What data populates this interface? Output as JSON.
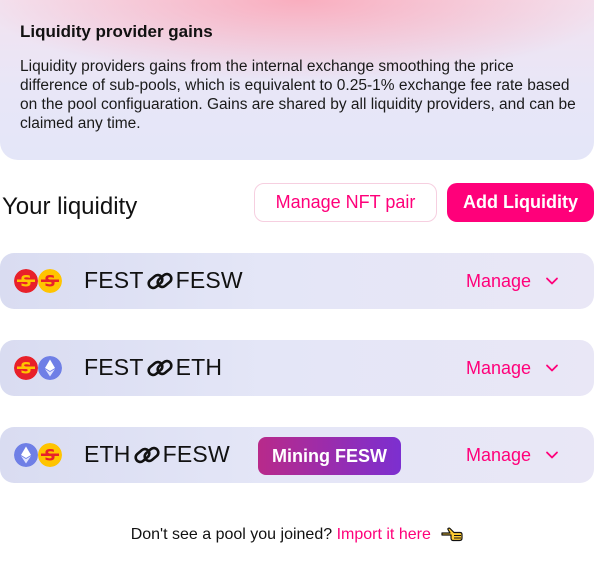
{
  "info": {
    "title": "Liquidity provider gains",
    "body": "Liquidity providers gains from the internal exchange smoothing the price difference of sub-pools, which is equivalent to 0.25-1% exchange fee rate based on the pool configuaration. Gains are shared by all liquidity providers, and can be claimed any time."
  },
  "liquidity": {
    "heading": "Your liquidity",
    "manage_nft_label": "Manage NFT pair",
    "add_liquidity_label": "Add Liquidity"
  },
  "pools": [
    {
      "token_a": "FEST",
      "token_b": "FESW",
      "manage_label": "Manage",
      "icon_a": "fest-token-icon",
      "icon_b": "fesw-token-icon"
    },
    {
      "token_a": "FEST",
      "token_b": "ETH",
      "manage_label": "Manage",
      "icon_a": "fest-token-icon",
      "icon_b": "eth-token-icon"
    },
    {
      "token_a": "ETH",
      "token_b": "FESW",
      "manage_label": "Manage",
      "badge": "Mining FESW",
      "icon_a": "eth-token-icon",
      "icon_b": "fesw-token-icon"
    }
  ],
  "footer": {
    "prompt": "Don't see a pool you joined?",
    "import_label": "Import it here"
  },
  "colors": {
    "accent": "#ff007a",
    "badge_from": "#b82a8a",
    "badge_to": "#7c2fd0",
    "fest_red": "#e8202a",
    "fest_yellow": "#ffc400",
    "eth_blue": "#6f7fe6"
  }
}
